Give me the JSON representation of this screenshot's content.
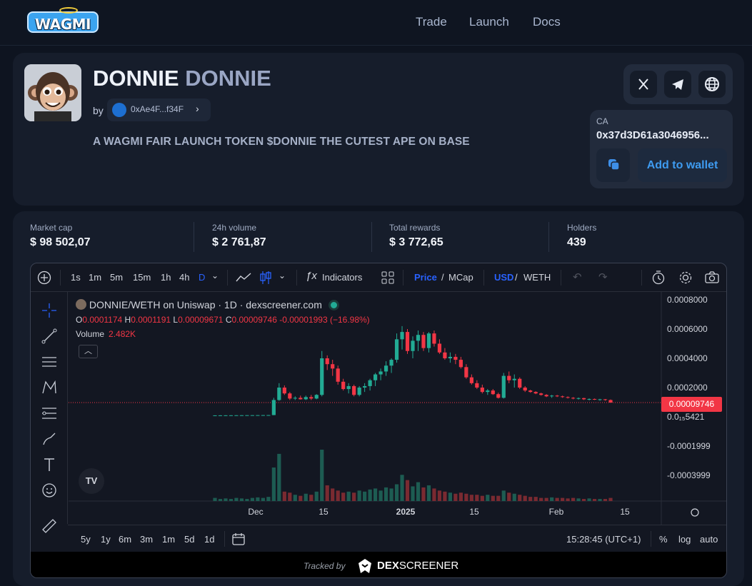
{
  "brand": {
    "logo_text": "WAGMI"
  },
  "nav": {
    "trade": "Trade",
    "launch": "Launch",
    "docs": "Docs"
  },
  "token": {
    "name": "DONNIE",
    "symbol": "DONNIE",
    "by_label": "by",
    "creator": "0xAe4F...f34F",
    "description": "A WAGMI FAIR LAUNCH TOKEN $DONNIE THE CUTEST APE ON BASE",
    "ca_label": "CA",
    "contract": "0x37d3D61a3046956...",
    "add_wallet_label": "Add to wallet",
    "social_icons": [
      "x-icon",
      "telegram-icon",
      "globe-icon"
    ]
  },
  "stats": [
    {
      "label": "Market cap",
      "value": "$ 98 502,07"
    },
    {
      "label": "24h volume",
      "value": "$ 2 761,87"
    },
    {
      "label": "Total rewards",
      "value": "$ 3 772,65"
    },
    {
      "label": "Holders",
      "value": "439"
    }
  ],
  "chart_toolbar": {
    "intervals": [
      "1s",
      "1m",
      "5m",
      "15m",
      "1h",
      "4h",
      "D"
    ],
    "active_interval": "D",
    "indicators": "Indicators",
    "price": "Price",
    "mcap": "MCap",
    "usd": "USD",
    "weth": "WETH"
  },
  "chart_legend": {
    "pair": "DONNIE/WETH on Uniswap · 1D · dexscreener.com",
    "ohlc": {
      "o_label": "O",
      "o": "0.0001174",
      "h_label": "H",
      "h": "0.0001191",
      "l_label": "L",
      "l": "0.00009671",
      "c_label": "C",
      "c": "0.00009746",
      "change": "-0.00001993 (−16.98%)"
    },
    "volume_label": "Volume",
    "volume_value": "2.482K",
    "tv_logo": "TV"
  },
  "chart_data": {
    "type": "candlestick",
    "y_ticks": [
      "0.0008000",
      "0.0006000",
      "0.0004000",
      "0.0002000",
      "0.0₁₅5421",
      "-0.0001999",
      "-0.0003999"
    ],
    "x_ticks": [
      "Dec",
      "15",
      "2025",
      "15",
      "Feb",
      "15"
    ],
    "last_price": "0.00009746",
    "up_color": "#22ab94",
    "down_color": "#f23645",
    "candles": [
      [
        1e-05,
        1.05e-05,
        9.5e-06,
        1e-05
      ],
      [
        1e-05,
        1.08e-05,
        9.6e-06,
        1.02e-05
      ],
      [
        1.02e-05,
        1.1e-05,
        9.8e-06,
        1.04e-05
      ],
      [
        1.04e-05,
        1.12e-05,
        1e-05,
        1.06e-05
      ],
      [
        1.06e-05,
        1.14e-05,
        1.02e-05,
        1.08e-05
      ],
      [
        1.08e-05,
        1.16e-05,
        1.04e-05,
        1.1e-05
      ],
      [
        1.1e-05,
        1.18e-05,
        1.06e-05,
        1.12e-05
      ],
      [
        1.12e-05,
        1.2e-05,
        1.08e-05,
        1.14e-05
      ],
      [
        1.14e-05,
        1.22e-05,
        1.1e-05,
        1.16e-05
      ],
      [
        1.16e-05,
        1.26e-05,
        1.12e-05,
        1.18e-05
      ],
      [
        1.18e-05,
        1.28e-05,
        1.14e-05,
        1.2e-05
      ],
      [
        1.2e-05,
        0.00013,
        1.15e-05,
        0.000115
      ],
      [
        0.000115,
        0.00023,
        0.00011,
        0.0002
      ],
      [
        0.0002,
        0.000215,
        0.00015,
        0.00016
      ],
      [
        0.00016,
        0.00017,
        0.000115,
        0.000125
      ],
      [
        0.000125,
        0.00014,
        0.000115,
        0.00013
      ],
      [
        0.00013,
        0.000145,
        0.000118,
        0.00012
      ],
      [
        0.00012,
        0.000145,
        0.000115,
        0.000135
      ],
      [
        0.000135,
        0.00015,
        0.000115,
        0.000125
      ],
      [
        0.000125,
        0.000155,
        0.00012,
        0.00015
      ],
      [
        0.00015,
        0.00045,
        0.00014,
        0.0004
      ],
      [
        0.0004,
        0.00042,
        0.00032,
        0.00036
      ],
      [
        0.00036,
        0.00039,
        0.00028,
        0.00033
      ],
      [
        0.00033,
        0.00035,
        0.00022,
        0.00024
      ],
      [
        0.00024,
        0.00026,
        0.00018,
        0.00019
      ],
      [
        0.00019,
        0.00023,
        0.00016,
        0.00021
      ],
      [
        0.00021,
        0.00022,
        0.00014,
        0.00015
      ],
      [
        0.00015,
        0.00021,
        0.00014,
        0.0002
      ],
      [
        0.0002,
        0.00023,
        0.00017,
        0.00021
      ],
      [
        0.00021,
        0.00026,
        0.00018,
        0.00025
      ],
      [
        0.00025,
        0.0003,
        0.00021,
        0.00029
      ],
      [
        0.00029,
        0.00033,
        0.00025,
        0.00031
      ],
      [
        0.00031,
        0.00038,
        0.00028,
        0.00035
      ],
      [
        0.00035,
        0.0004,
        0.0003,
        0.00039
      ],
      [
        0.00039,
        0.00057,
        0.00037,
        0.00053
      ],
      [
        0.00053,
        0.00062,
        0.00046,
        0.00058
      ],
      [
        0.00058,
        0.0006,
        0.00043,
        0.00045
      ],
      [
        0.00045,
        0.00055,
        0.0004,
        0.00052
      ],
      [
        0.00052,
        0.00059,
        0.00045,
        0.00056
      ],
      [
        0.00056,
        0.00058,
        0.00045,
        0.00047
      ],
      [
        0.00047,
        0.00058,
        0.00044,
        0.00057
      ],
      [
        0.00057,
        0.00059,
        0.00048,
        0.0005
      ],
      [
        0.0005,
        0.00053,
        0.00043,
        0.00044
      ],
      [
        0.00044,
        0.00047,
        0.00039,
        0.0004
      ],
      [
        0.0004,
        0.00044,
        0.00037,
        0.00041
      ],
      [
        0.00041,
        0.00043,
        0.00036,
        0.00039
      ],
      [
        0.00039,
        0.00041,
        0.00033,
        0.00034
      ],
      [
        0.00034,
        0.00036,
        0.00026,
        0.00027
      ],
      [
        0.00027,
        0.00029,
        0.00022,
        0.00023
      ],
      [
        0.00023,
        0.00025,
        0.00019,
        0.0002
      ],
      [
        0.0002,
        0.00022,
        0.00016,
        0.00017
      ],
      [
        0.00017,
        0.00019,
        0.00015,
        0.00018
      ],
      [
        0.00018,
        0.00019,
        0.00015,
        0.000155
      ],
      [
        0.000155,
        0.000165,
        0.000125,
        0.00013
      ],
      [
        0.00013,
        0.0003,
        0.000125,
        0.00028
      ],
      [
        0.00028,
        0.00031,
        0.00023,
        0.00025
      ],
      [
        0.00025,
        0.00029,
        0.0002,
        0.00026
      ],
      [
        0.00026,
        0.00027,
        0.00019,
        0.0002
      ],
      [
        0.0002,
        0.00021,
        0.00017,
        0.00018
      ],
      [
        0.00018,
        0.000185,
        0.000165,
        0.00017
      ],
      [
        0.00017,
        0.000175,
        0.000155,
        0.00016
      ],
      [
        0.00016,
        0.000165,
        0.000145,
        0.00015
      ],
      [
        0.00015,
        0.000155,
        0.000135,
        0.00014
      ],
      [
        0.00014,
        0.00015,
        0.00013,
        0.000145
      ],
      [
        0.000145,
        0.00015,
        0.000135,
        0.00014
      ],
      [
        0.00014,
        0.000145,
        0.00013,
        0.000135
      ],
      [
        0.000135,
        0.00014,
        0.000125,
        0.00013
      ],
      [
        0.00013,
        0.000135,
        0.00012,
        0.000125
      ],
      [
        0.000125,
        0.000132,
        0.000118,
        0.000128
      ],
      [
        0.000128,
        0.00013,
        0.000115,
        0.00012
      ],
      [
        0.00012,
        0.000126,
        0.000112,
        0.000122
      ],
      [
        0.000122,
        0.000125,
        0.000115,
        0.000118
      ],
      [
        0.000118,
        0.000123,
        0.00011,
        0.00012
      ],
      [
        0.00012,
        0.000122,
        0.00011,
        0.000115
      ],
      [
        0.000115,
        0.0001191,
        9.67e-05,
        9.75e-05
      ]
    ],
    "volumes": [
      0.3,
      0.2,
      0.25,
      0.2,
      0.3,
      0.25,
      0.2,
      0.3,
      0.35,
      0.3,
      0.4,
      3.2,
      4.5,
      0.9,
      0.8,
      0.6,
      0.5,
      0.7,
      0.6,
      0.9,
      4.9,
      1.5,
      1.2,
      1.0,
      0.8,
      0.9,
      0.8,
      1.0,
      0.9,
      1.1,
      1.2,
      1.0,
      1.3,
      1.2,
      1.6,
      2.5,
      2.0,
      1.4,
      1.8,
      1.3,
      1.5,
      1.2,
      1.0,
      0.9,
      0.8,
      0.7,
      0.8,
      0.7,
      0.6,
      0.6,
      0.5,
      0.6,
      0.5,
      0.5,
      1.0,
      0.8,
      0.7,
      0.6,
      0.5,
      0.4,
      0.4,
      0.3,
      0.3,
      0.35,
      0.3,
      0.3,
      0.25,
      0.3,
      0.25,
      0.2,
      0.25,
      0.2,
      0.2,
      0.2,
      0.3
    ]
  },
  "chart_bottom": {
    "ranges": [
      "5y",
      "1y",
      "6m",
      "3m",
      "1m",
      "5d",
      "1d"
    ],
    "clock": "15:28:45 (UTC+1)",
    "pct": "%",
    "log": "log",
    "auto": "auto"
  },
  "tracked": {
    "label": "Tracked by",
    "brand_a": "DEX",
    "brand_b": "SCREENER"
  }
}
